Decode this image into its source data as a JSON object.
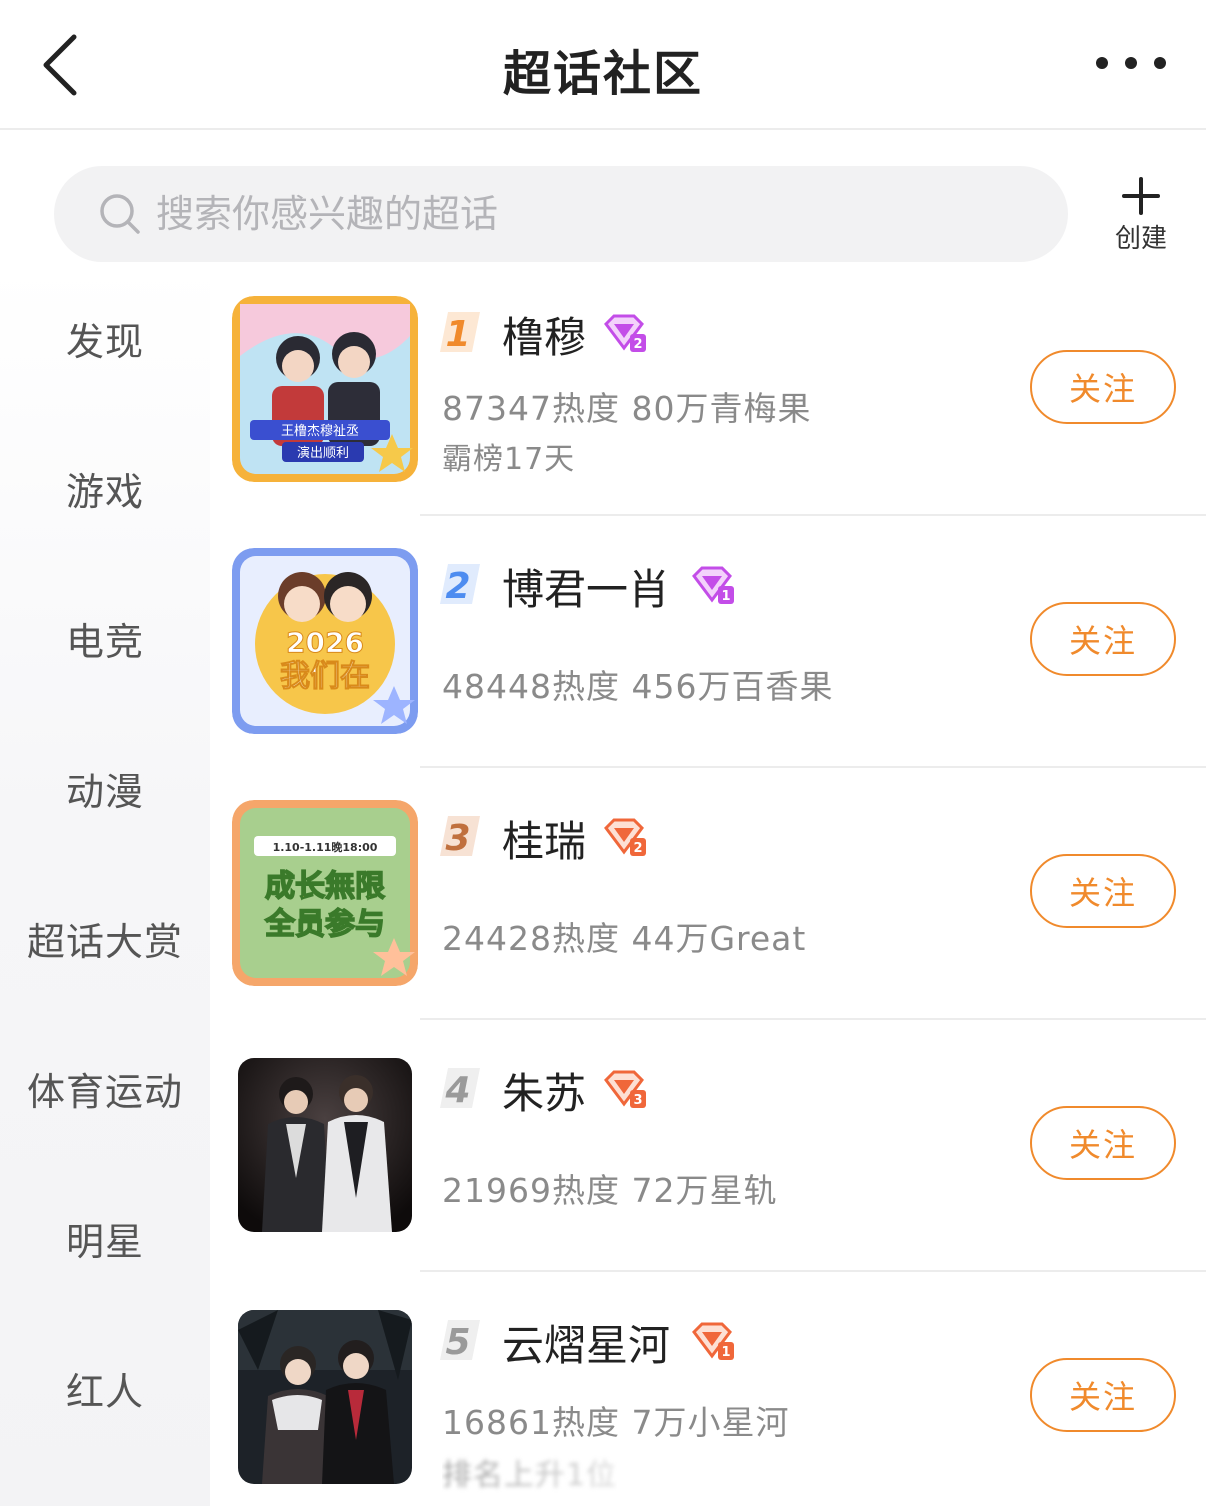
{
  "header": {
    "title": "超话社区"
  },
  "search": {
    "placeholder": "搜索你感兴趣的超话",
    "value": ""
  },
  "create": {
    "label": "创建"
  },
  "sidebar": {
    "items": [
      {
        "label": "发现"
      },
      {
        "label": "游戏"
      },
      {
        "label": "电竞"
      },
      {
        "label": "动漫"
      },
      {
        "label": "超话大赏"
      },
      {
        "label": "体育运动"
      },
      {
        "label": "明星"
      },
      {
        "label": "红人"
      }
    ]
  },
  "topics": [
    {
      "rank": "1",
      "name": "橹穆",
      "level": "2",
      "stats": "87347热度 80万青梅果",
      "extra": "霸榜17天",
      "follow_label": "关注",
      "rank_color": "#f08a2c",
      "level_color": "#c34de8",
      "avatar_text": [
        "王橹杰穆祉丞",
        "演出顺利"
      ]
    },
    {
      "rank": "2",
      "name": "博君一肖",
      "level": "1",
      "stats": "48448热度 456万百香果",
      "extra": "",
      "follow_label": "关注",
      "rank_color": "#4d8cf0",
      "level_color": "#c34de8",
      "avatar_text": [
        "2026",
        "我们在"
      ]
    },
    {
      "rank": "3",
      "name": "桂瑞",
      "level": "2",
      "stats": "24428热度 44万Great",
      "extra": "",
      "follow_label": "关注",
      "rank_color": "#c0703e",
      "level_color": "#f0673a",
      "avatar_text": [
        "1.10-1.11晚18:00",
        "成长無限",
        "全员参与"
      ]
    },
    {
      "rank": "4",
      "name": "朱苏",
      "level": "3",
      "stats": "21969热度 72万星轨",
      "extra": "",
      "follow_label": "关注",
      "rank_color": "#9a9a9a",
      "level_color": "#f0673a",
      "avatar_text": []
    },
    {
      "rank": "5",
      "name": "云熠星河",
      "level": "1",
      "stats": "16861热度 7万小星河",
      "extra": "排名上升1位",
      "follow_label": "关注",
      "rank_color": "#9a9a9a",
      "level_color": "#f0673a",
      "avatar_text": []
    }
  ]
}
